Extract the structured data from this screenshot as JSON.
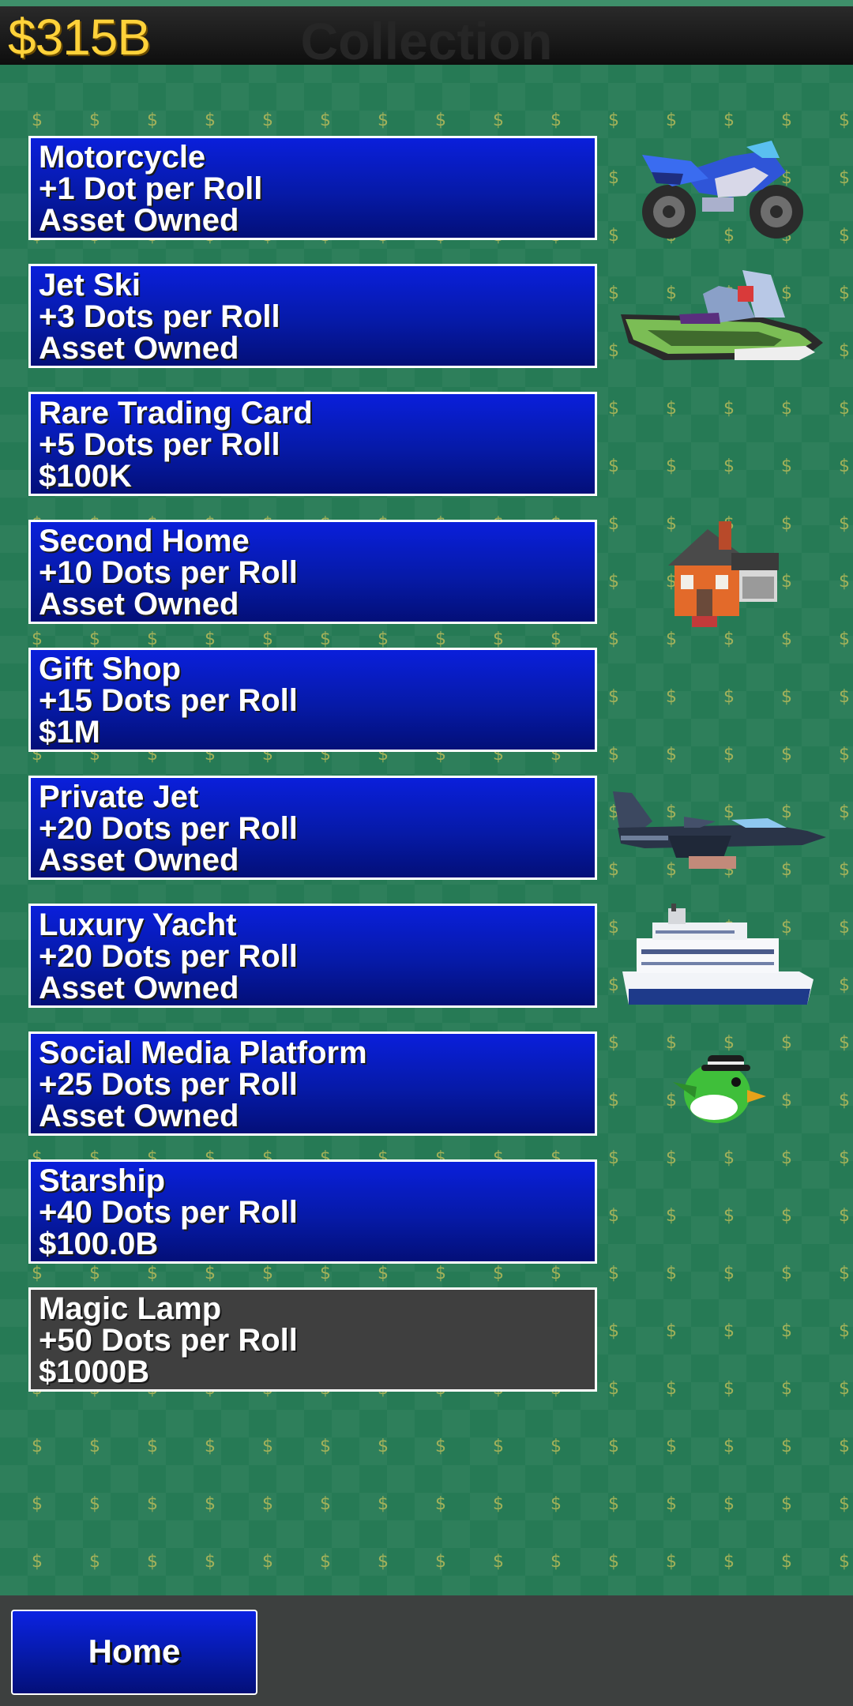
{
  "header": {
    "money": "$315B",
    "title": "Collection"
  },
  "assets": [
    {
      "name": "Motorcycle",
      "rate": "+1 Dot per Roll",
      "status": "Asset Owned",
      "owned": true,
      "icon": "motorcycle-icon"
    },
    {
      "name": "Jet Ski",
      "rate": "+3 Dots per Roll",
      "status": "Asset Owned",
      "owned": true,
      "icon": "jet-ski-icon"
    },
    {
      "name": "Rare Trading Card",
      "rate": "+5 Dots per Roll",
      "status": "$100K",
      "owned": false,
      "icon": ""
    },
    {
      "name": "Second Home",
      "rate": "+10 Dots per Roll",
      "status": "Asset Owned",
      "owned": true,
      "icon": "house-icon"
    },
    {
      "name": "Gift Shop",
      "rate": "+15 Dots per Roll",
      "status": "$1M",
      "owned": false,
      "icon": ""
    },
    {
      "name": "Private Jet",
      "rate": "+20 Dots per Roll",
      "status": "Asset Owned",
      "owned": true,
      "icon": "jet-icon"
    },
    {
      "name": "Luxury Yacht",
      "rate": "+20 Dots per Roll",
      "status": "Asset Owned",
      "owned": true,
      "icon": "yacht-icon"
    },
    {
      "name": "Social Media Platform",
      "rate": "+25 Dots per Roll",
      "status": "Asset Owned",
      "owned": true,
      "icon": "bird-icon"
    },
    {
      "name": "Starship",
      "rate": "+40 Dots per Roll",
      "status": "$100.0B",
      "owned": false,
      "icon": ""
    },
    {
      "name": "Magic Lamp",
      "rate": "+50 Dots per Roll",
      "status": "$1000B",
      "owned": false,
      "locked": true,
      "icon": ""
    }
  ],
  "footer": {
    "home_label": "Home"
  },
  "colors": {
    "background": "#267a55",
    "card_blue": "#061aa8",
    "card_locked": "#3f3f3f",
    "money_gold": "#ffd23a",
    "dollar_pattern": "#c9c25a"
  }
}
